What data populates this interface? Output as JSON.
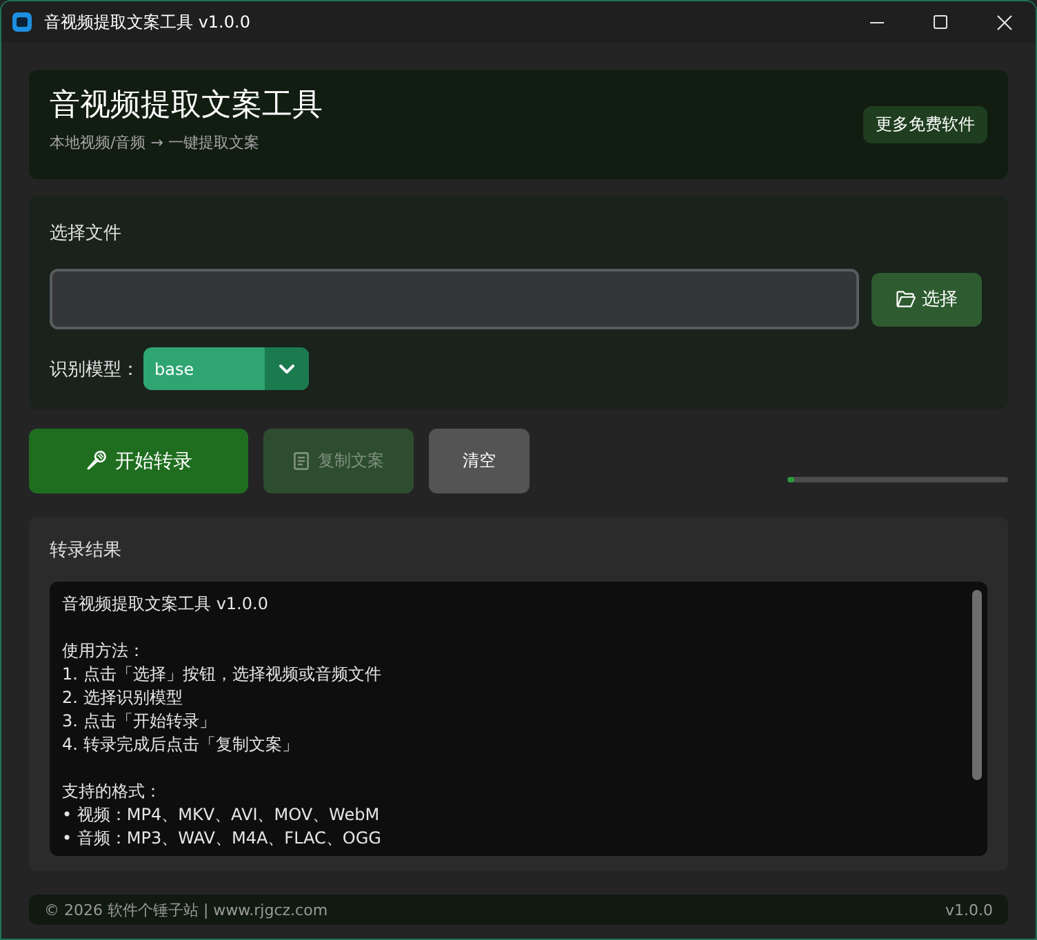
{
  "window": {
    "title": "音视频提取文案工具 v1.0.0"
  },
  "header": {
    "title": "音视频提取文案工具",
    "subtitle": "本地视频/音频 → 一键提取文案",
    "link_button": "更多免费软件"
  },
  "file_section": {
    "label": "选择文件",
    "browse_button": "选择",
    "model": {
      "label": "识别模型：",
      "value": "base"
    }
  },
  "actions": [
    {
      "label": "开始转录",
      "kind": "primary",
      "disabled": false
    },
    {
      "label": "复制文案",
      "kind": "secondary",
      "disabled": true
    },
    {
      "label": "清空",
      "kind": "neutral",
      "disabled": false
    }
  ],
  "progress": {
    "level": 0.03
  },
  "result": {
    "label": "转录结果",
    "paragraphs": [
      [
        "音视频提取文案工具 v1.0.0"
      ],
      [
        "使用方法：",
        "1. 点击「选择」按钮，选择视频或音频文件",
        "2. 选择识别模型",
        "3. 点击「开始转录」",
        "4. 转录完成后点击「复制文案」"
      ],
      [
        "支持的格式：",
        "• 视频：MP4、MKV、AVI、MOV、WebM",
        "• 音频：MP3、WAV、M4A、FLAC、OGG"
      ]
    ]
  },
  "footer": {
    "left": "© 2026 软件个锤子站 | www.rjgcz.com",
    "right": "v1.0.0"
  }
}
